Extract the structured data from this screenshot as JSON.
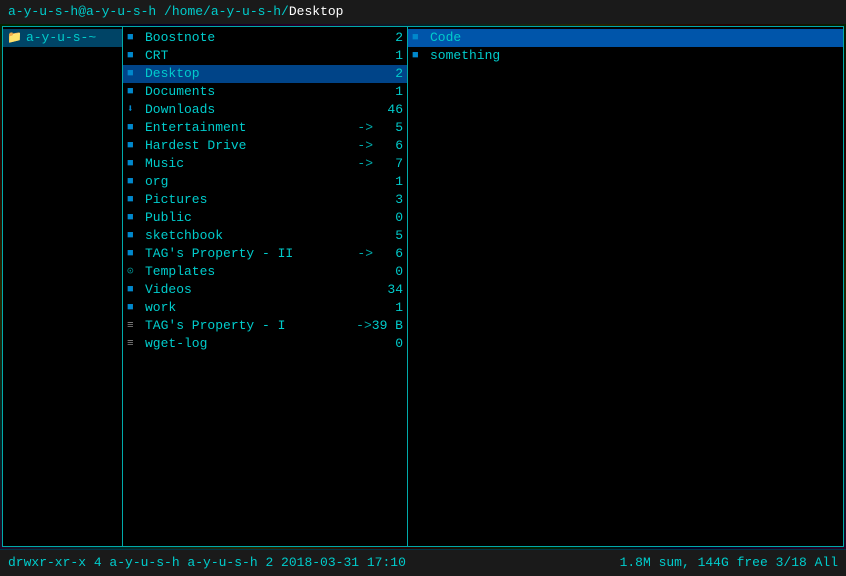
{
  "terminal": {
    "title": "a-y-u-s-h@a-y-u-s-h /home/a-y-u-s-h/Desktop",
    "title_parts": {
      "user_host": "a-y-u-s-h@a-y-u-s-h",
      "path_home": " /home/a-y-u-s-h/",
      "path_current": "Desktop"
    }
  },
  "left_panel": {
    "items": [
      {
        "icon": "folder",
        "label": "a-y-u-s-~",
        "selected": true
      }
    ]
  },
  "middle_panel": {
    "items": [
      {
        "icon": "folder",
        "name": "Boostnote",
        "count": "2",
        "arrow": "",
        "selected": false
      },
      {
        "icon": "folder",
        "name": "CRT",
        "count": "1",
        "arrow": "",
        "selected": false
      },
      {
        "icon": "folder",
        "name": "Desktop",
        "count": "2",
        "arrow": "",
        "selected": true
      },
      {
        "icon": "folder",
        "name": "Documents",
        "count": "1",
        "arrow": "",
        "selected": false
      },
      {
        "icon": "folder_down",
        "name": "Downloads",
        "count": "46",
        "arrow": "",
        "selected": false
      },
      {
        "icon": "folder",
        "name": "Entertainment",
        "count": "5",
        "arrow": "->",
        "selected": false
      },
      {
        "icon": "folder",
        "name": "Hardest Drive",
        "count": "6",
        "arrow": "->",
        "selected": false
      },
      {
        "icon": "folder",
        "name": "Music",
        "count": "7",
        "arrow": "->",
        "selected": false
      },
      {
        "icon": "folder",
        "name": "org",
        "count": "1",
        "arrow": "",
        "selected": false
      },
      {
        "icon": "folder",
        "name": "Pictures",
        "count": "3",
        "arrow": "",
        "selected": false
      },
      {
        "icon": "folder",
        "name": "Public",
        "count": "0",
        "arrow": "",
        "selected": false
      },
      {
        "icon": "folder",
        "name": "sketchbook",
        "count": "5",
        "arrow": "",
        "selected": false
      },
      {
        "icon": "folder",
        "name": "TAG's Property - II",
        "count": "6",
        "arrow": "->",
        "selected": false
      },
      {
        "icon": "template",
        "name": "Templates",
        "count": "0",
        "arrow": "",
        "selected": false
      },
      {
        "icon": "folder",
        "name": "Videos",
        "count": "34",
        "arrow": "",
        "selected": false
      },
      {
        "icon": "folder",
        "name": "work",
        "count": "1",
        "arrow": "",
        "selected": false
      },
      {
        "icon": "list",
        "name": "TAG's Property - I",
        "count": "39 B",
        "arrow": "->",
        "selected": false
      },
      {
        "icon": "list",
        "name": "wget-log",
        "count": "0",
        "arrow": "",
        "selected": false
      }
    ]
  },
  "right_panel": {
    "items": [
      {
        "icon": "folder",
        "name": "Code",
        "selected": true
      },
      {
        "icon": "folder",
        "name": "something",
        "selected": false
      }
    ]
  },
  "status_bar": {
    "left": "drwxr-xr-x 4 a-y-u-s-h a-y-u-s-h 2 2018-03-31 17:10",
    "right": "1.8M sum, 144G free  3/18  All"
  }
}
